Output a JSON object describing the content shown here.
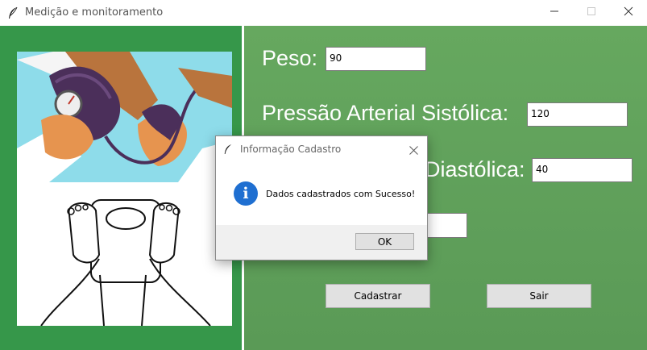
{
  "window": {
    "title": "Medição e monitoramento",
    "icon": "feather-icon",
    "controls": [
      "minimize-icon",
      "maximize-icon",
      "close-icon"
    ]
  },
  "form": {
    "peso_label": "Peso:",
    "peso_value": "90",
    "sistolica_label": "Pressão Arterial Sistólica:",
    "sistolica_value": "120",
    "diastolica_label": "Diastólica:",
    "diastolica_value": "40",
    "fourth_value": ""
  },
  "buttons": {
    "cadastrar": "Cadastrar",
    "sair": "Sair"
  },
  "dialog": {
    "title": "Informação Cadastro",
    "message": "Dados cadastrados com Sucesso!",
    "icon": "info-icon",
    "icon_glyph": "i",
    "ok": "OK"
  },
  "images": [
    "blood-pressure-illustration",
    "scale-feet-illustration"
  ],
  "colors": {
    "panel_green": "#36974a",
    "background_green": "#5fa05f",
    "dialog_info_blue": "#1f6fd1"
  }
}
